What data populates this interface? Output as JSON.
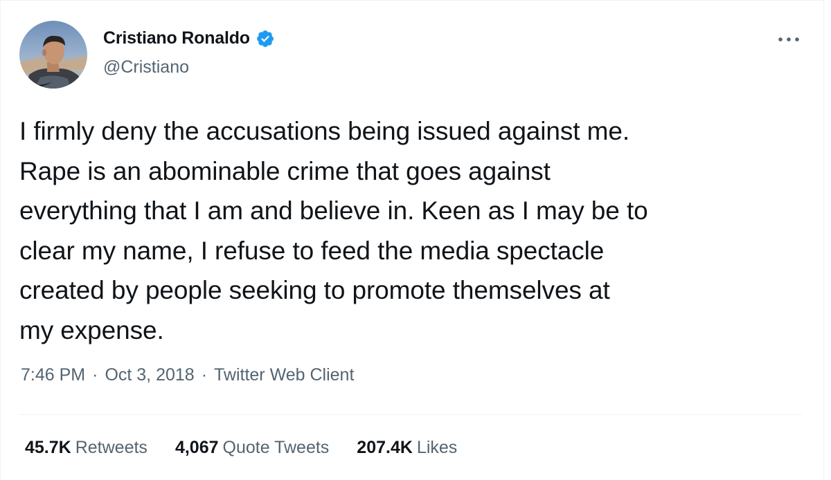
{
  "tweet": {
    "author": {
      "display_name": "Cristiano Ronaldo",
      "handle": "@Cristiano",
      "verified": true,
      "verified_icon": "verified-badge-icon",
      "avatar_icon": "profile-avatar"
    },
    "more_icon": "ellipsis-icon",
    "text": "I firmly deny the accusations being issued against me.\nRape is an abominable crime that goes against\neverything that I am and believe in. Keen as I may be to\nclear my name, I refuse to feed the media spectacle\ncreated by people seeking to promote themselves at\nmy expense.",
    "meta": {
      "time": "7:46 PM",
      "separator": "·",
      "date": "Oct 3, 2018",
      "source": "Twitter Web Client"
    },
    "stats": [
      {
        "count": "45.7K",
        "label": "Retweets"
      },
      {
        "count": "4,067",
        "label": "Quote Tweets"
      },
      {
        "count": "207.4K",
        "label": "Likes"
      }
    ]
  },
  "colors": {
    "text_primary": "#0f1419",
    "text_secondary": "#536471",
    "verified_blue": "#1d9bf0",
    "divider": "#eff3f4"
  }
}
